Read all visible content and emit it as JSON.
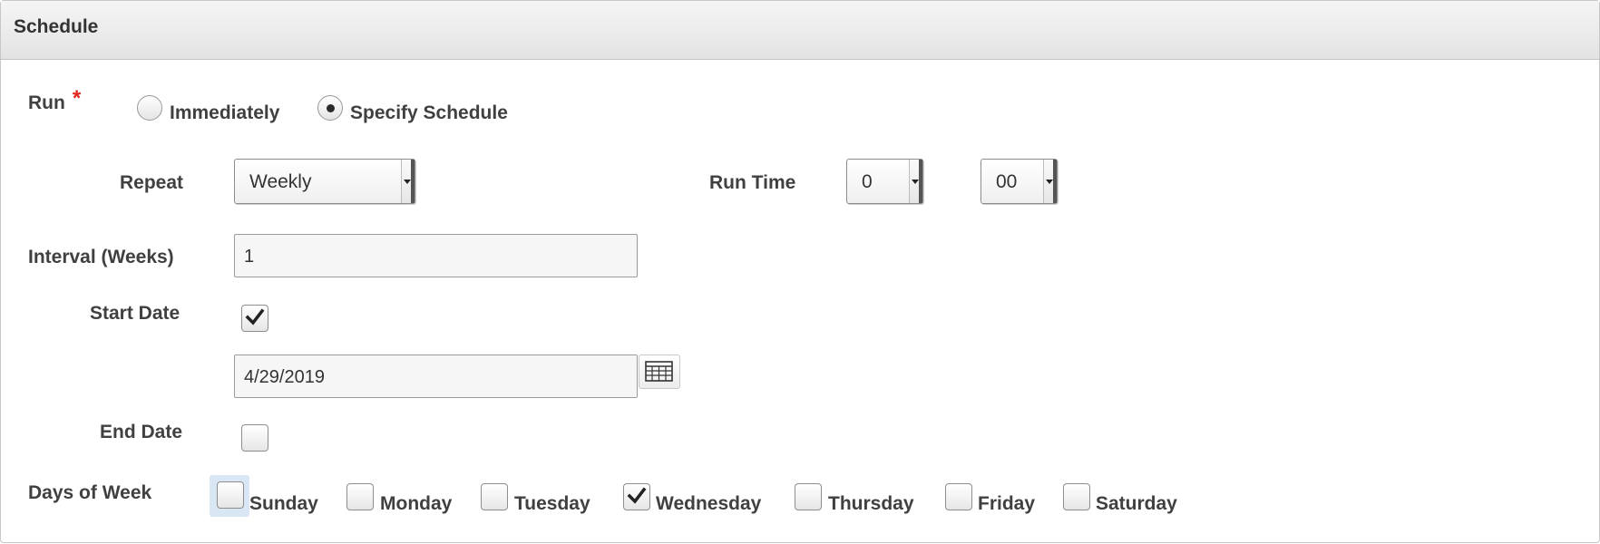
{
  "header": {
    "title": "Schedule"
  },
  "run": {
    "label": "Run",
    "required_marker": "*",
    "options": [
      {
        "label": "Immediately",
        "selected": false
      },
      {
        "label": "Specify Schedule",
        "selected": true
      }
    ]
  },
  "repeat": {
    "label": "Repeat",
    "value": "Weekly"
  },
  "run_time": {
    "label": "Run Time",
    "hour": "0",
    "minute": "00"
  },
  "interval": {
    "label": "Interval (Weeks)",
    "value": "1"
  },
  "start_date": {
    "label": "Start Date",
    "checked": true,
    "value": "4/29/2019"
  },
  "end_date": {
    "label": "End Date",
    "checked": false
  },
  "days_of_week": {
    "label": "Days of Week",
    "days": [
      {
        "label": "Sunday",
        "checked": false
      },
      {
        "label": "Monday",
        "checked": false
      },
      {
        "label": "Tuesday",
        "checked": false
      },
      {
        "label": "Wednesday",
        "checked": true
      },
      {
        "label": "Thursday",
        "checked": false
      },
      {
        "label": "Friday",
        "checked": false
      },
      {
        "label": "Saturday",
        "checked": false
      }
    ]
  },
  "icons": {
    "calendar": "calendar-icon",
    "check": "checkmark-icon",
    "dropdown": "chevron-down-icon"
  },
  "colors": {
    "required": "#e0231b",
    "focus": "#d9e6f3",
    "header_bg": "#e8e8e8"
  }
}
